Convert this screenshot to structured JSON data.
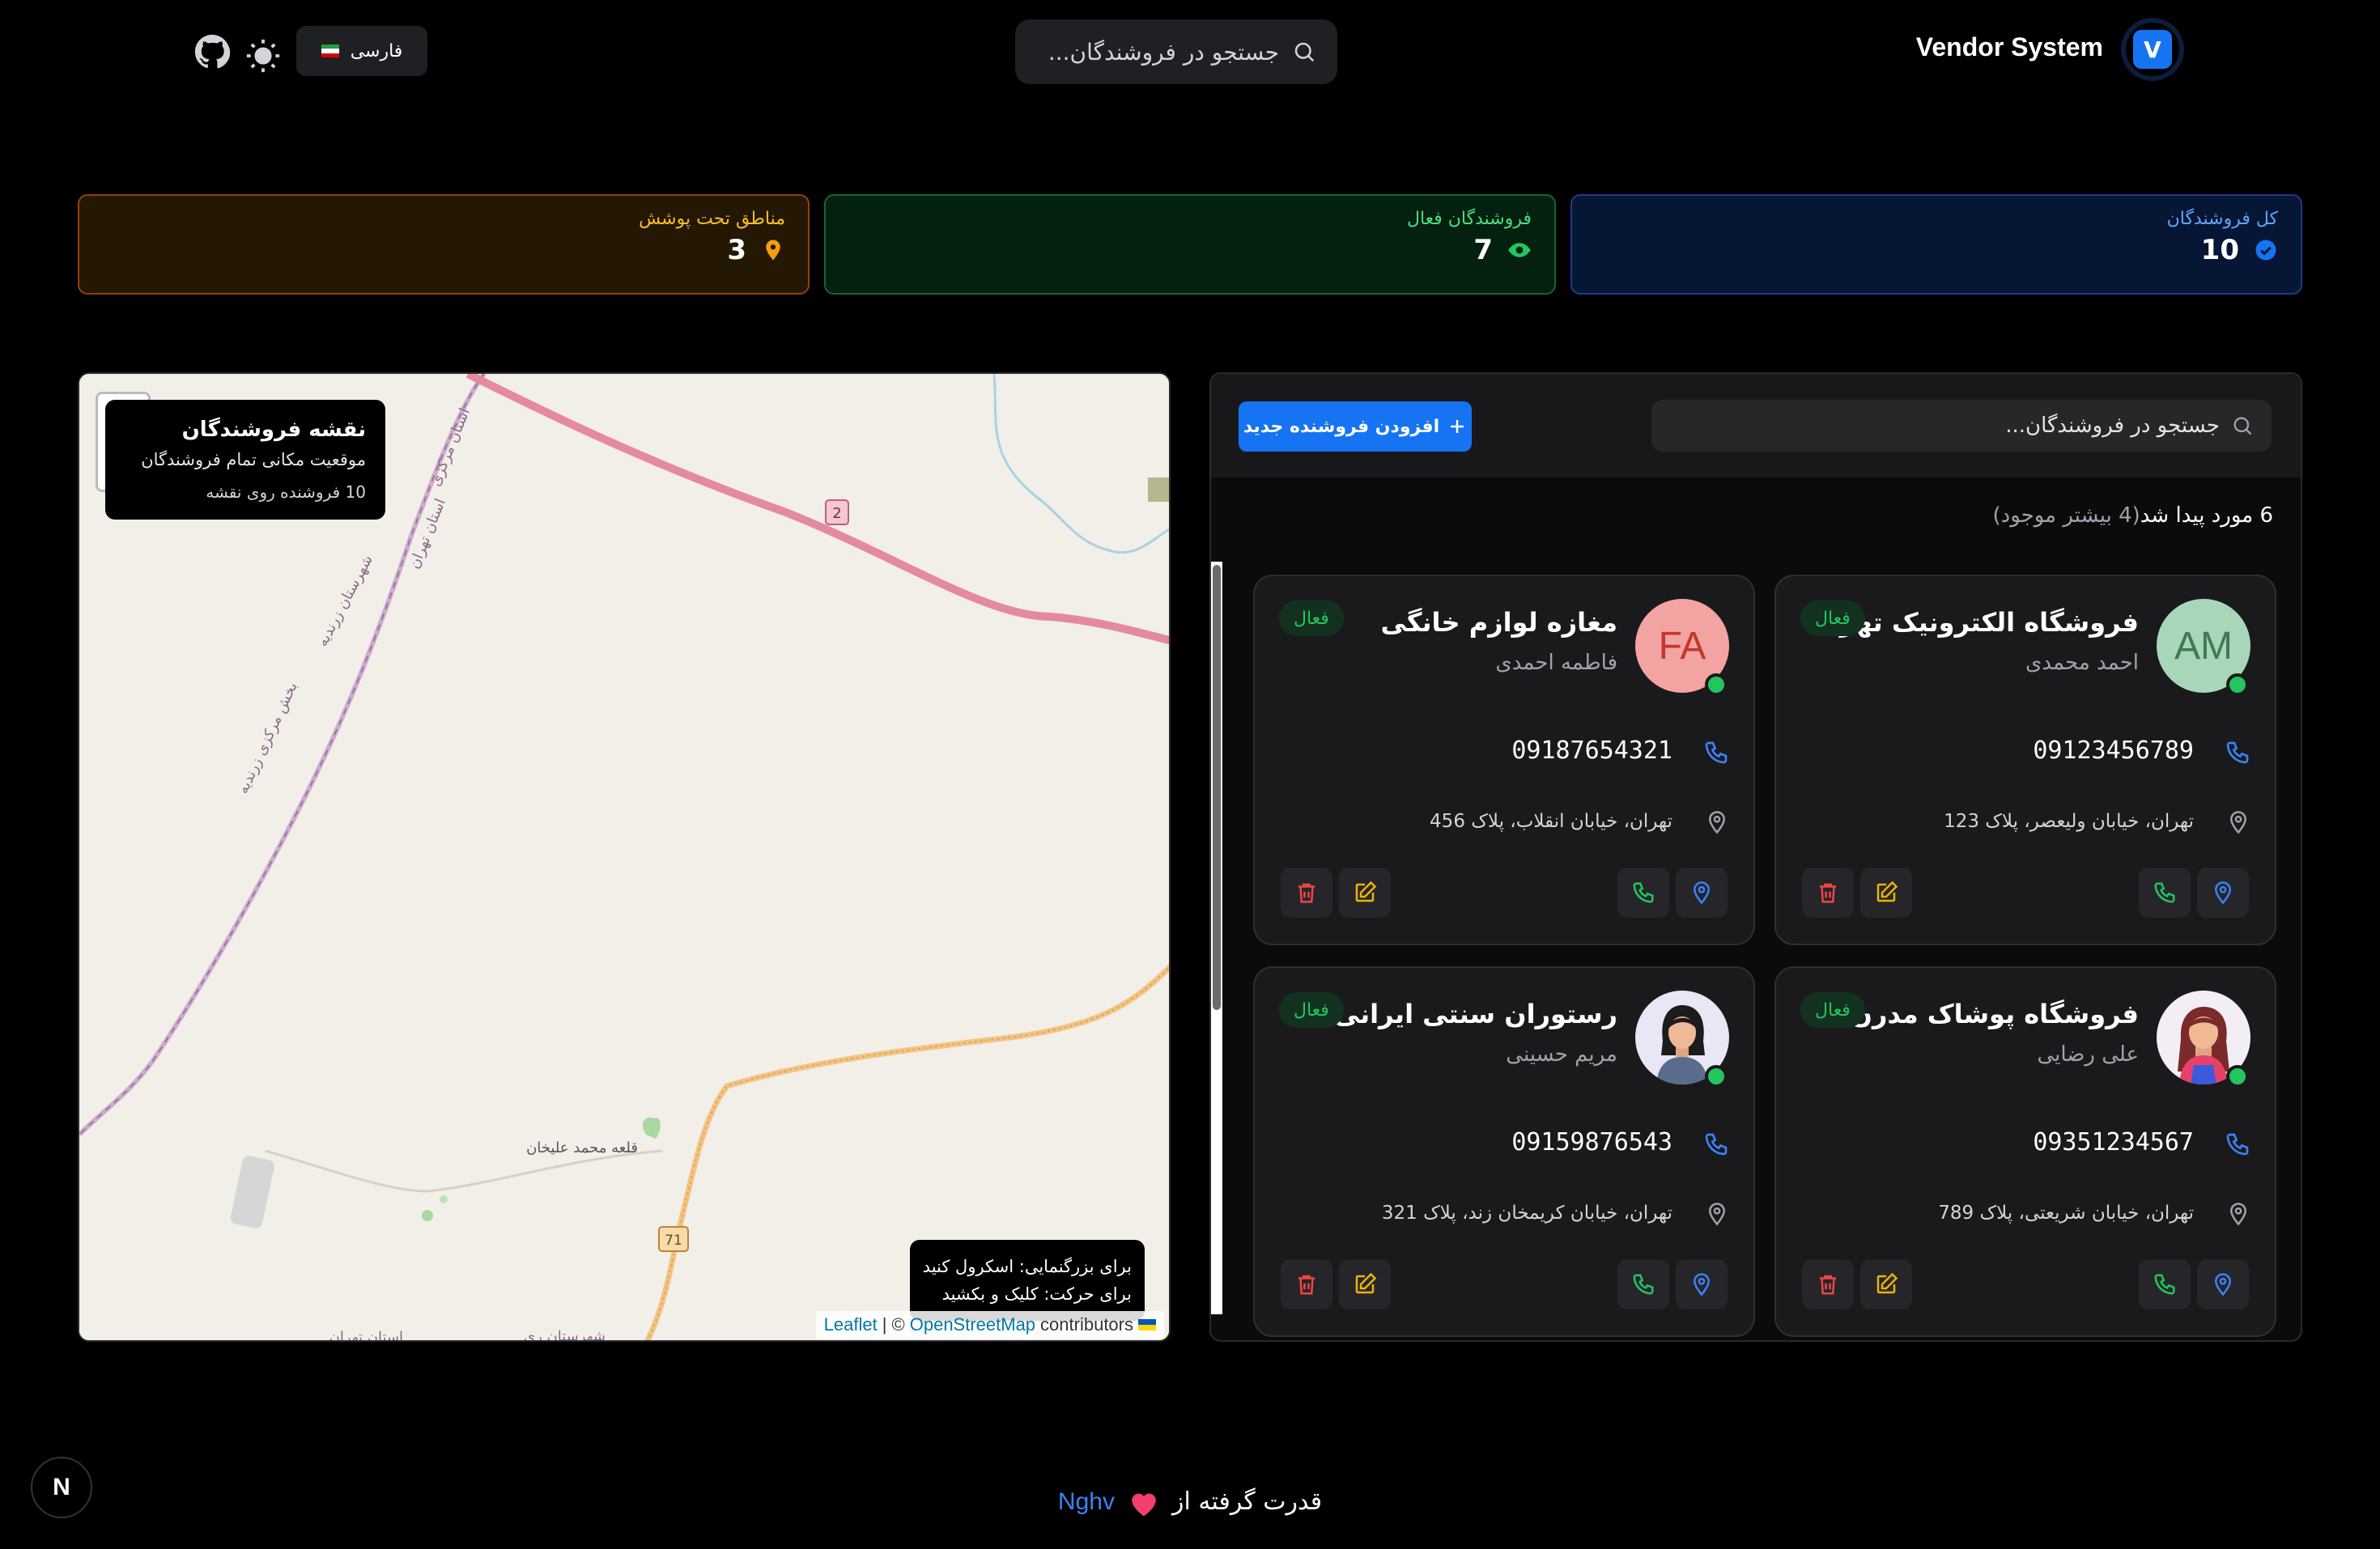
{
  "header": {
    "logo_letter": "V",
    "brand": "Vendor System",
    "search_placeholder": "جستجو در فروشندگان...",
    "language": "فارسی"
  },
  "stats": [
    {
      "label": "کل فروشندگان",
      "value": "10",
      "color": "#1674f2"
    },
    {
      "label": "فروشندگان فعال",
      "value": "7",
      "color": "#22c55e"
    },
    {
      "label": "مناطق تحت پوشش",
      "value": "3",
      "color": "#f59e0b"
    }
  ],
  "map": {
    "title": "نقشه فروشندگان",
    "subtitle": "موقعیت مکانی تمام فروشندگان",
    "count_text": "10 فروشنده روی نقشه",
    "hint_zoom": "برای بزرگنمایی: اسکرول کنید",
    "hint_move": "برای حرکت: کلیک و بکشید",
    "attribution_leaflet": "Leaflet",
    "attribution_sep": "| ©",
    "attribution_osm": "OpenStreetMap",
    "attribution_tail": "contributors",
    "labels": {
      "road_2": "2",
      "road_71": "71",
      "village": "قلعه محمد علیخان",
      "ostan_markazi": "استان مرکزی",
      "ostan_tehran": "استان تهران",
      "shahrestan_zarandieh": "شهرستان زرندیه",
      "bakhsh_markazi": "بخش مرکزی زرندیه",
      "shahrestan_rey": "شهرستان ری",
      "ostan_tehran_bottom": "استان تهران"
    }
  },
  "panel": {
    "search_placeholder": "جستجو در فروشندگان...",
    "add_button": "افزودن فروشنده جدید",
    "found_text": "6 مورد پیدا شد",
    "more_text": "(4 بیشتر موجود)"
  },
  "vendors": [
    {
      "name": "فروشگاه الکترونیک تهران",
      "owner": "احمد محمدی",
      "initials": "AM",
      "avatar_bg": "#a7d7b8",
      "avatar_fg": "#3f7a56",
      "status": "فعال",
      "phone": "09123456789",
      "address": "تهران، خیابان ولیعصر، پلاک 123"
    },
    {
      "name": "مغازه لوازم خانگی",
      "owner": "فاطمه احمدی",
      "initials": "FA",
      "avatar_bg": "#f4a3a3",
      "avatar_fg": "#c0392b",
      "status": "فعال",
      "phone": "09187654321",
      "address": "تهران، خیابان انقلاب، پلاک 456"
    },
    {
      "name": "فروشگاه پوشاک مدرن",
      "owner": "علی رضایی",
      "initials": "",
      "avatar_bg": "#f3eef6",
      "avatar_fg": "#000000",
      "status": "فعال",
      "phone": "09351234567",
      "address": "تهران، خیابان شریعتی، پلاک 789"
    },
    {
      "name": "رستوران سنتی ایرانی",
      "owner": "مریم حسینی",
      "initials": "",
      "avatar_bg": "#e9e6f5",
      "avatar_fg": "#000000",
      "status": "فعال",
      "phone": "09159876543",
      "address": "تهران، خیابان کریمخان زند، پلاک 321"
    }
  ],
  "footer": {
    "powered": "قدرت گرفته از",
    "author": "Nghv",
    "next_letter": "N"
  }
}
